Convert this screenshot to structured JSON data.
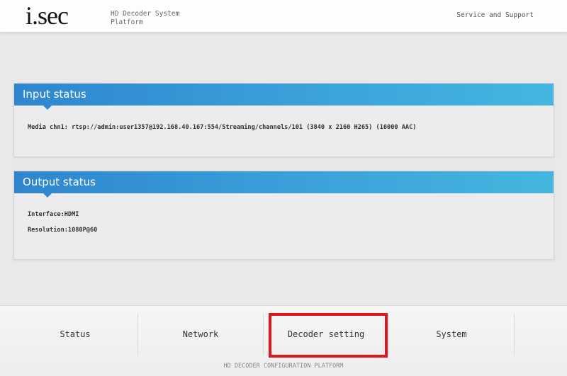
{
  "header": {
    "logo": "i.sec",
    "subtitle_line1": "HD Decoder System",
    "subtitle_line2": "Platform",
    "support_link": "Service and Support"
  },
  "input_status": {
    "title": "Input status",
    "media_line": "Media chn1: rtsp://admin:user1357@192.168.40.167:554/Streaming/channels/101 (3840 x 2160 H265) (16000 AAC)"
  },
  "output_status": {
    "title": "Output status",
    "interface": "Interface:HDMI",
    "resolution": "Resolution:1080P@60"
  },
  "nav": {
    "tabs": [
      {
        "label": "Status"
      },
      {
        "label": "Network"
      },
      {
        "label": "Decoder setting"
      },
      {
        "label": "System"
      }
    ],
    "highlighted_tab": "Decoder setting",
    "highlight_color": "#e0171f"
  },
  "footer": {
    "caption": "HD DECODER CONFIGURATION PLATFORM"
  },
  "colors": {
    "panel_header_start": "#2f86cf",
    "panel_header_end": "#44b6e0",
    "background": "#e9e9ea"
  }
}
